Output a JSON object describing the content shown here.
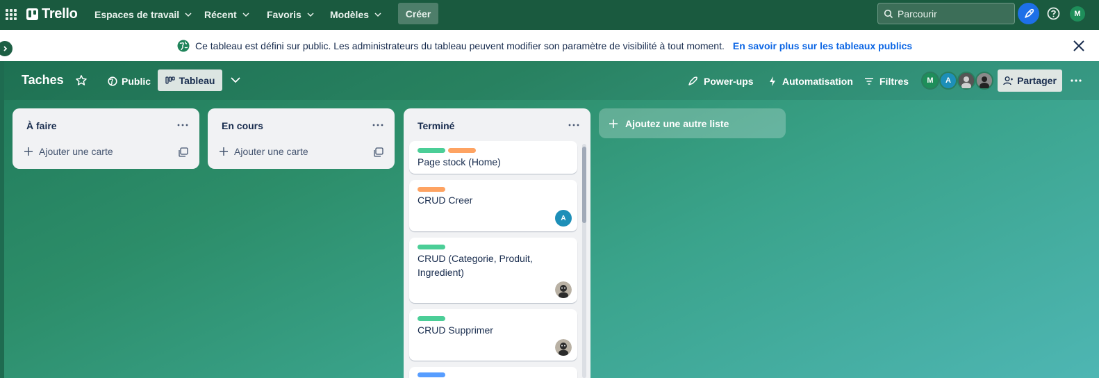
{
  "topnav": {
    "logo": "Trello",
    "menus": [
      {
        "label": "Espaces de travail"
      },
      {
        "label": "Récent"
      },
      {
        "label": "Favoris"
      },
      {
        "label": "Modèles"
      }
    ],
    "create_label": "Créer",
    "search_placeholder": "Parcourir",
    "user_initial": "M"
  },
  "banner": {
    "message": "Ce tableau est défini sur public. Les administrateurs du tableau peuvent modifier son paramètre de visibilité à tout moment.",
    "link": "En savoir plus sur les tableaux publics"
  },
  "board": {
    "title": "Taches",
    "visibility": "Public",
    "view": "Tableau",
    "powerups": "Power-ups",
    "automation": "Automatisation",
    "filters": "Filtres",
    "share": "Partager",
    "members": [
      {
        "initial": "M",
        "color": "#1e8e5a"
      },
      {
        "initial": "A",
        "color": "#1d8fb8"
      },
      {
        "initial": "",
        "color": "#4a4a4a"
      },
      {
        "initial": "",
        "color": "#6b6b6b"
      }
    ]
  },
  "colors": {
    "label_green": "#4bce97",
    "label_orange": "#fea362",
    "label_blue": "#579dff"
  },
  "lists": [
    {
      "title": "À faire",
      "add_card": "Ajouter une carte"
    },
    {
      "title": "En cours",
      "add_card": "Ajouter une carte"
    },
    {
      "title": "Terminé",
      "cards": [
        {
          "text": "Page stock (Home)",
          "labels": [
            "green",
            "orange"
          ]
        },
        {
          "text": "CRUD Creer",
          "labels": [
            "orange"
          ],
          "member": "A"
        },
        {
          "text": "CRUD (Categorie, Produit, Ingredient)",
          "labels": [
            "green"
          ],
          "member": "photo"
        },
        {
          "text": "CRUD Supprimer",
          "labels": [
            "green"
          ],
          "member": "photo"
        }
      ]
    }
  ],
  "add_list_label": "Ajoutez une autre liste"
}
